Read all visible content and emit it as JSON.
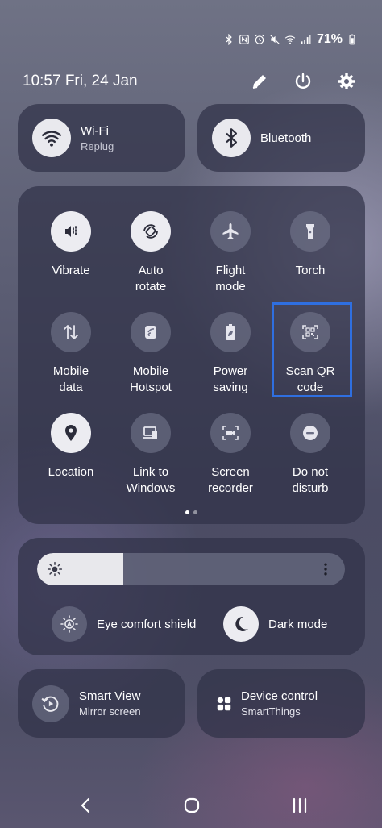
{
  "status": {
    "battery": "71%"
  },
  "header": {
    "datetime": "10:57  Fri, 24 Jan"
  },
  "wifi": {
    "title": "Wi-Fi",
    "network": "Replug"
  },
  "bluetooth": {
    "title": "Bluetooth"
  },
  "tiles": [
    {
      "label": "Vibrate",
      "icon": "vibrate-icon",
      "on": true
    },
    {
      "label": "Auto\nrotate",
      "icon": "auto-rotate-icon",
      "on": true
    },
    {
      "label": "Flight\nmode",
      "icon": "airplane-icon",
      "on": false
    },
    {
      "label": "Torch",
      "icon": "flashlight-icon",
      "on": false
    },
    {
      "label": "Mobile\ndata",
      "icon": "mobile-data-icon",
      "on": false
    },
    {
      "label": "Mobile\nHotspot",
      "icon": "hotspot-icon",
      "on": false
    },
    {
      "label": "Power\nsaving",
      "icon": "battery-leaf-icon",
      "on": false
    },
    {
      "label": "Scan QR\ncode",
      "icon": "qr-scan-icon",
      "on": false
    },
    {
      "label": "Location",
      "icon": "location-pin-icon",
      "on": true
    },
    {
      "label": "Link to\nWindows",
      "icon": "link-to-windows-icon",
      "on": false
    },
    {
      "label": "Screen\nrecorder",
      "icon": "screen-recorder-icon",
      "on": false
    },
    {
      "label": "Do not\ndisturb",
      "icon": "do-not-disturb-icon",
      "on": false
    }
  ],
  "pager": {
    "pages": 2,
    "active": 0
  },
  "brightness": {
    "level": 0.28
  },
  "modes": {
    "eye_comfort": "Eye comfort shield",
    "dark_mode": "Dark mode"
  },
  "smart_view": {
    "title": "Smart View",
    "subtitle": "Mirror screen"
  },
  "device_control": {
    "title": "Device control",
    "subtitle": "SmartThings"
  },
  "colors": {
    "highlight": "#2f6fe0",
    "tile_on": "#ececf1",
    "tile_off": "#787b92"
  }
}
